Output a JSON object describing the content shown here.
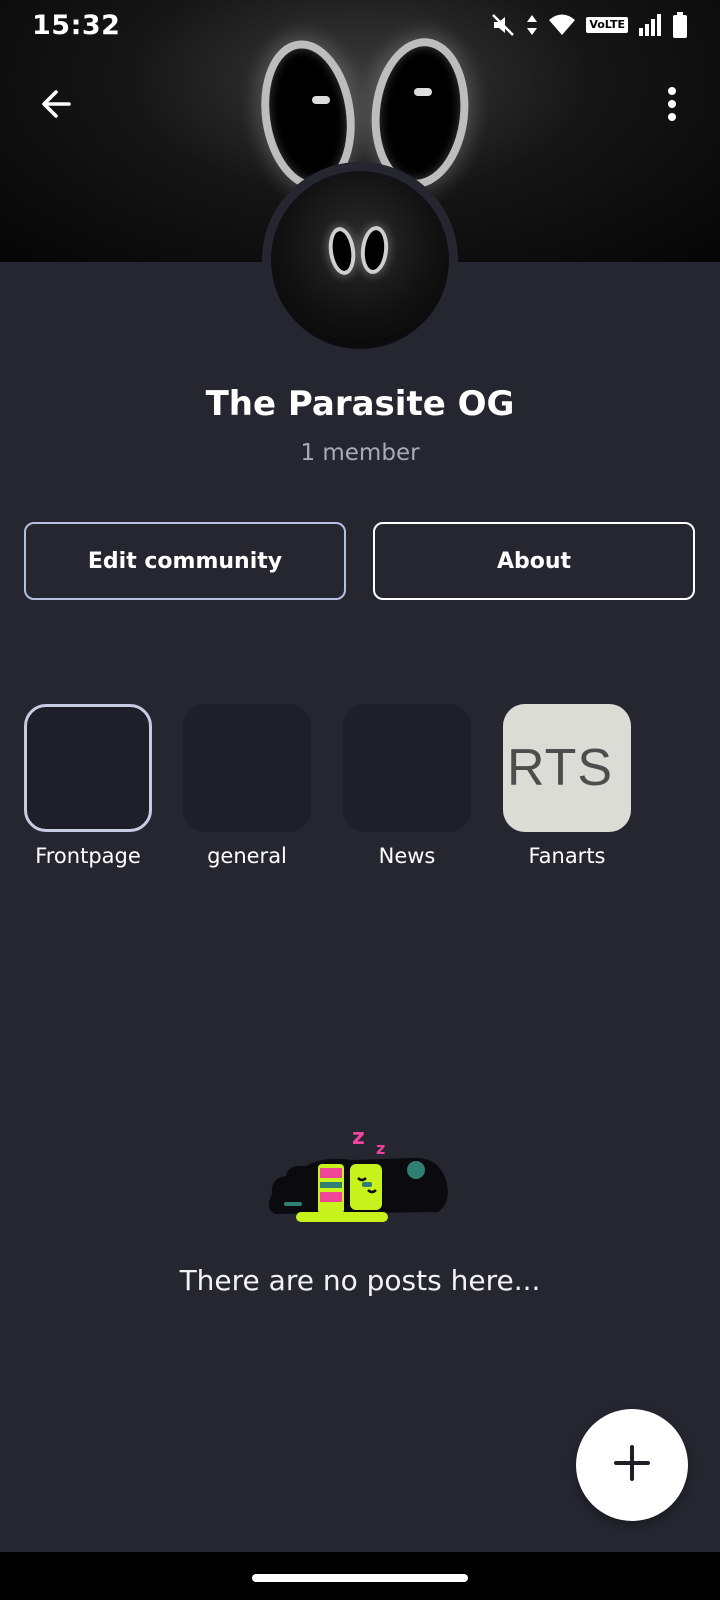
{
  "status_bar": {
    "time": "15:32",
    "volte": "VoLTE",
    "icons": [
      "mute-icon",
      "data-arrows-icon",
      "wifi-icon",
      "signal-icon",
      "battery-icon"
    ]
  },
  "header": {
    "back_icon": "arrow-left-icon",
    "more_icon": "more-vertical-icon"
  },
  "community": {
    "name": "The Parasite OG",
    "members": "1 member"
  },
  "actions": {
    "edit_label": "Edit community",
    "about_label": "About"
  },
  "channels": [
    {
      "label": "Frontpage",
      "active": true
    },
    {
      "label": "general",
      "active": false
    },
    {
      "label": "News",
      "active": false
    },
    {
      "label": "Fanarts",
      "active": false,
      "thumb_text": "RTS"
    }
  ],
  "empty_state": {
    "zzz": "z z",
    "message": "There are no posts here..."
  },
  "fab": {
    "icon": "plus-icon"
  },
  "colors": {
    "background": "#262631",
    "tile": "#1e1f29",
    "muted_text": "#a9abb6",
    "accent_green": "#c8f21c",
    "accent_pink": "#f0449a"
  }
}
